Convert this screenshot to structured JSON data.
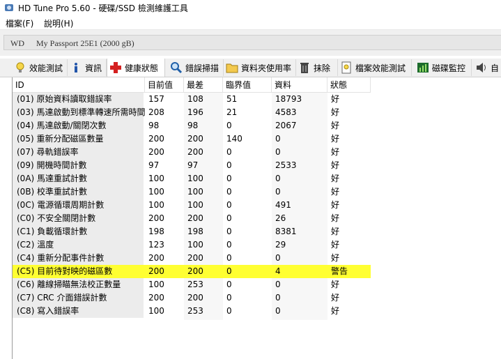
{
  "window": {
    "title": "HD Tune Pro 5.60 - 硬碟/SSD 檢測維護工具"
  },
  "menu": {
    "items": [
      "檔案(F)",
      "說明(H)"
    ]
  },
  "drive": {
    "brand": "WD",
    "model": "My Passport 25E1 (2000 gB)"
  },
  "tabs": [
    {
      "label": "效能測試",
      "icon": "lightbulb-icon"
    },
    {
      "label": "資訊",
      "icon": "info-icon"
    },
    {
      "label": "健康狀態",
      "icon": "health-cross-icon",
      "active": true
    },
    {
      "label": "錯誤掃描",
      "icon": "magnifier-icon"
    },
    {
      "label": "資料夾使用率",
      "icon": "folder-icon"
    },
    {
      "label": "抹除",
      "icon": "trash-icon"
    },
    {
      "label": "檔案效能測試",
      "icon": "file-benchmark-icon"
    },
    {
      "label": "磁碟監控",
      "icon": "disk-monitor-icon"
    },
    {
      "label": "自",
      "icon": "speaker-icon"
    }
  ],
  "table": {
    "headers": [
      "ID",
      "目前值",
      "最差",
      "臨界值",
      "資料",
      "狀態"
    ],
    "rows": [
      {
        "id": "(01) 原始資料讀取錯誤率",
        "current": "157",
        "worst": "108",
        "threshold": "51",
        "data": "18793",
        "status": "好"
      },
      {
        "id": "(03) 馬達啟動到標準轉速所需時間",
        "current": "208",
        "worst": "196",
        "threshold": "21",
        "data": "4583",
        "status": "好"
      },
      {
        "id": "(04) 馬達啟動/關閉次數",
        "current": "98",
        "worst": "98",
        "threshold": "0",
        "data": "2067",
        "status": "好"
      },
      {
        "id": "(05) 重新分配磁區數量",
        "current": "200",
        "worst": "200",
        "threshold": "140",
        "data": "0",
        "status": "好"
      },
      {
        "id": "(07) 尋軌錯誤率",
        "current": "200",
        "worst": "200",
        "threshold": "0",
        "data": "0",
        "status": "好"
      },
      {
        "id": "(09) 開機時間計數",
        "current": "97",
        "worst": "97",
        "threshold": "0",
        "data": "2533",
        "status": "好"
      },
      {
        "id": "(0A) 馬達重試計數",
        "current": "100",
        "worst": "100",
        "threshold": "0",
        "data": "0",
        "status": "好"
      },
      {
        "id": "(0B) 校準重試計數",
        "current": "100",
        "worst": "100",
        "threshold": "0",
        "data": "0",
        "status": "好"
      },
      {
        "id": "(0C) 電源循環周期計數",
        "current": "100",
        "worst": "100",
        "threshold": "0",
        "data": "491",
        "status": "好"
      },
      {
        "id": "(C0) 不安全關閉計數",
        "current": "200",
        "worst": "200",
        "threshold": "0",
        "data": "26",
        "status": "好"
      },
      {
        "id": "(C1) 負載循環計數",
        "current": "198",
        "worst": "198",
        "threshold": "0",
        "data": "8381",
        "status": "好"
      },
      {
        "id": "(C2) 溫度",
        "current": "123",
        "worst": "100",
        "threshold": "0",
        "data": "29",
        "status": "好"
      },
      {
        "id": "(C4) 重新分配事件計數",
        "current": "200",
        "worst": "200",
        "threshold": "0",
        "data": "0",
        "status": "好"
      },
      {
        "id": "(C5) 目前待對映的磁區數",
        "current": "200",
        "worst": "200",
        "threshold": "0",
        "data": "4",
        "status": "警告",
        "highlight": true
      },
      {
        "id": "(C6) 離線掃瞄無法校正數量",
        "current": "100",
        "worst": "253",
        "threshold": "0",
        "data": "0",
        "status": "好"
      },
      {
        "id": "(C7) CRC 介面錯誤計數",
        "current": "200",
        "worst": "200",
        "threshold": "0",
        "data": "0",
        "status": "好"
      },
      {
        "id": "(C8) 寫入錯誤率",
        "current": "100",
        "worst": "253",
        "threshold": "0",
        "data": "0",
        "status": "好"
      }
    ]
  },
  "colors": {
    "warning_highlight": "#ffff32",
    "id_column_bg": "#ececec"
  }
}
